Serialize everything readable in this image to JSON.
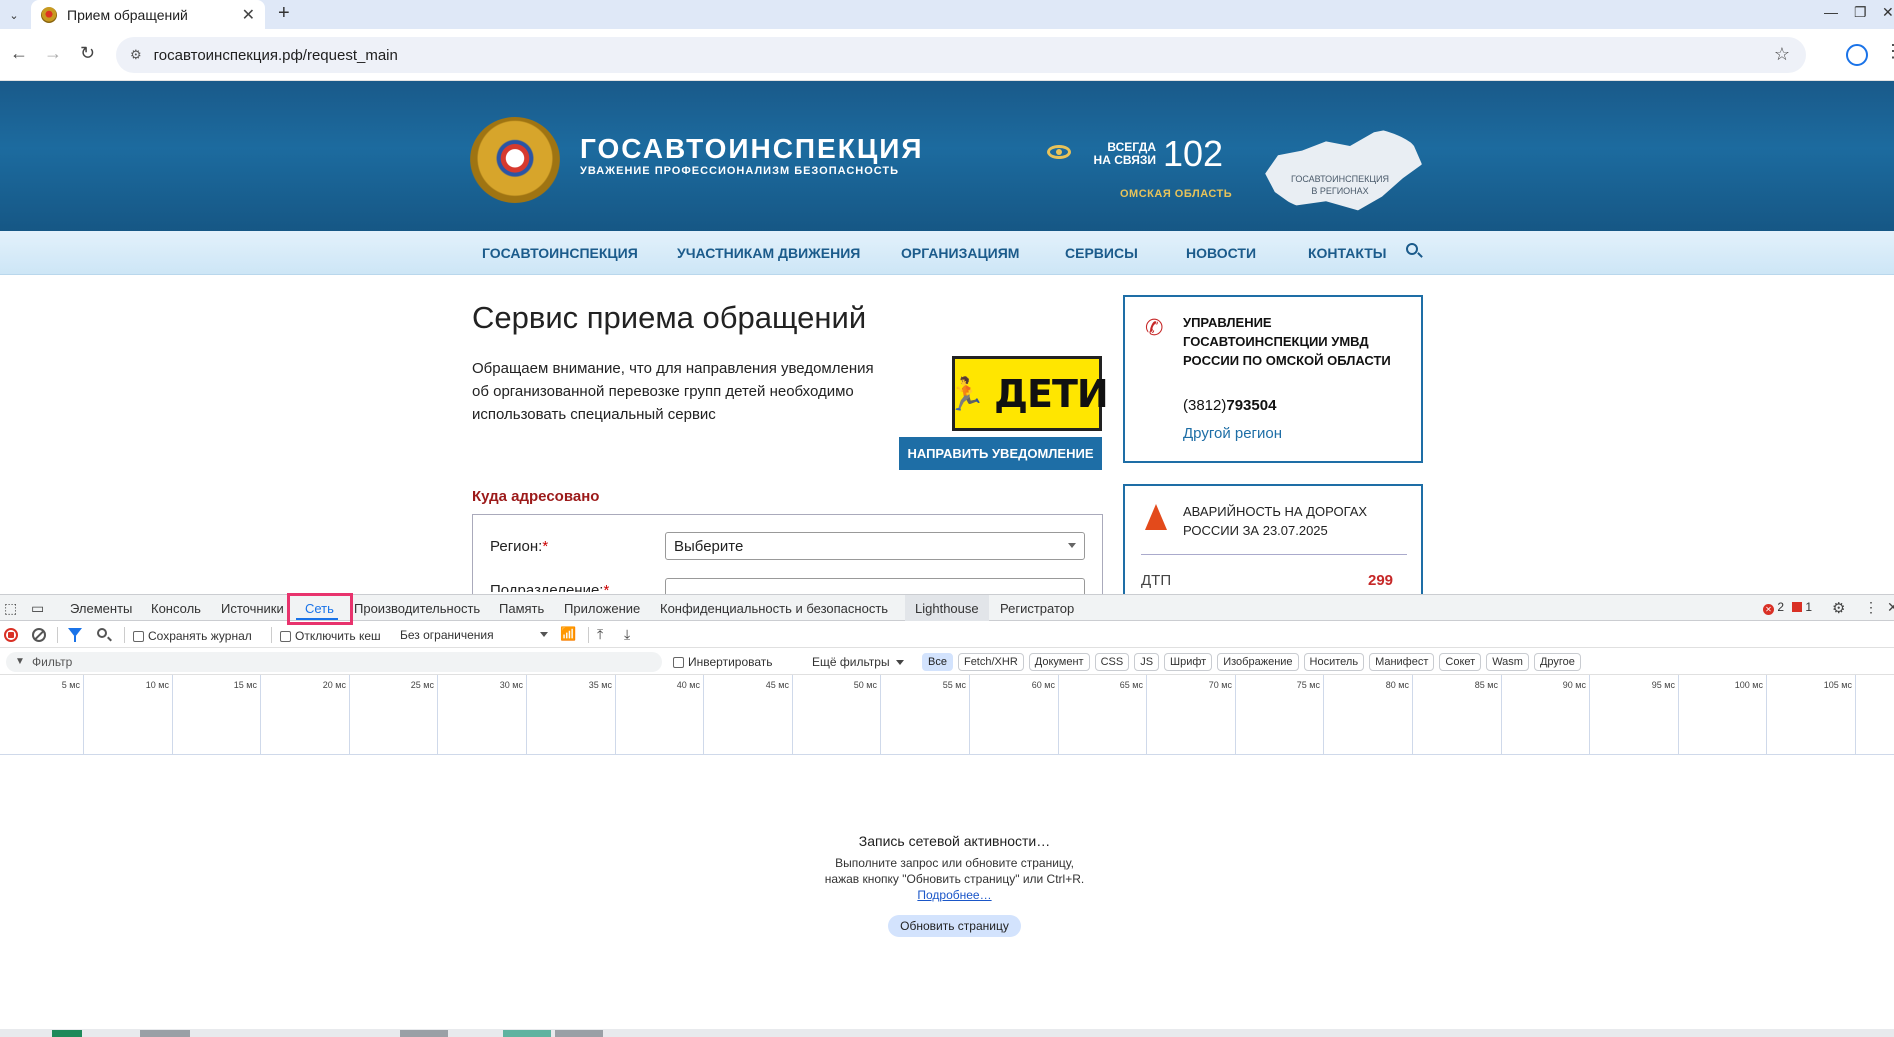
{
  "browser": {
    "tab_title": "Прием обращений",
    "tab_close": "✕",
    "new_tab": "+",
    "url": "госавтоинспекция.рф/request_main",
    "win_minimize": "—",
    "win_restore": "❐",
    "win_close": "✕"
  },
  "site": {
    "brand_title": "ГОСАВТОИНСПЕКЦИЯ",
    "brand_subtitle": "УВАЖЕНИЕ ПРОФЕССИОНАЛИЗМ БЕЗОПАСНОСТЬ",
    "always_line1": "ВСЕГДА",
    "always_line2": "НА СВЯЗИ",
    "phone": "102",
    "region": "ОМСКАЯ ОБЛАСТЬ",
    "map_label": "ГОСАВТОИНСПЕКЦИЯ В РЕГИОНАХ",
    "nav": [
      "ГОСАВТОИНСПЕКЦИЯ",
      "УЧАСТНИКАМ ДВИЖЕНИЯ",
      "ОРГАНИЗАЦИЯМ",
      "СЕРВИСЫ",
      "НОВОСТИ",
      "КОНТАКТЫ"
    ],
    "page_title": "Сервис приема обращений",
    "notice": "Обращаем внимание, что для направления уведомления об организованной перевозке групп детей необходимо использовать специальный сервис",
    "deti_word": "ДЕТИ",
    "send_button": "НАПРАВИТЬ УВЕДОМЛЕНИЕ",
    "section_label": "Куда адресовано",
    "region_label": "Регион:",
    "region_select": "Выберите",
    "subdivision_label": "Подразделение:",
    "required_mark": "*",
    "card1": {
      "title": "УПРАВЛЕНИЕ ГОСАВТОИНСПЕКЦИИ УМВД РОССИИ ПО ОМСКОЙ ОБЛАСТИ",
      "phone_code": "(3812)",
      "phone_number": "793504",
      "link": "Другой регион"
    },
    "card2": {
      "title": "АВАРИЙНОСТЬ НА ДОРОГАХ РОССИИ ЗА 23.07.2025",
      "dtp_label": "ДТП",
      "dtp_value": "299"
    }
  },
  "devtools": {
    "tabs": [
      "Элементы",
      "Консоль",
      "Источники",
      "Сеть",
      "Производительность",
      "Память",
      "Приложение",
      "Конфиденциальность и безопасность",
      "Lighthouse",
      "Регистратор"
    ],
    "errors": "2",
    "issues": "1",
    "preserve_log": "Сохранять журнал",
    "disable_cache": "Отключить кеш",
    "throttling": "Без ограничения",
    "filter_placeholder": "Фильтр",
    "invert": "Инвертировать",
    "more_filters": "Ещё фильтры",
    "type_filters": [
      "Все",
      "Fetch/XHR",
      "Документ",
      "CSS",
      "JS",
      "Шрифт",
      "Изображение",
      "Носитель",
      "Манифест",
      "Сокет",
      "Wasm",
      "Другое"
    ],
    "timeline_ticks": [
      "5 мс",
      "10 мс",
      "15 мс",
      "20 мс",
      "25 мс",
      "30 мс",
      "35 мс",
      "40 мс",
      "45 мс",
      "50 мс",
      "55 мс",
      "60 мс",
      "65 мс",
      "70 мс",
      "75 мс",
      "80 мс",
      "85 мс",
      "90 мс",
      "95 мс",
      "100 мс",
      "105 мс"
    ],
    "empty_title": "Запись сетевой активности…",
    "empty_text": "Выполните запрос или обновите страницу, нажав кнопку \"Обновить страницу\" или Ctrl+R.",
    "empty_link": "Подробнее…",
    "reload_button": "Обновить страницу"
  }
}
